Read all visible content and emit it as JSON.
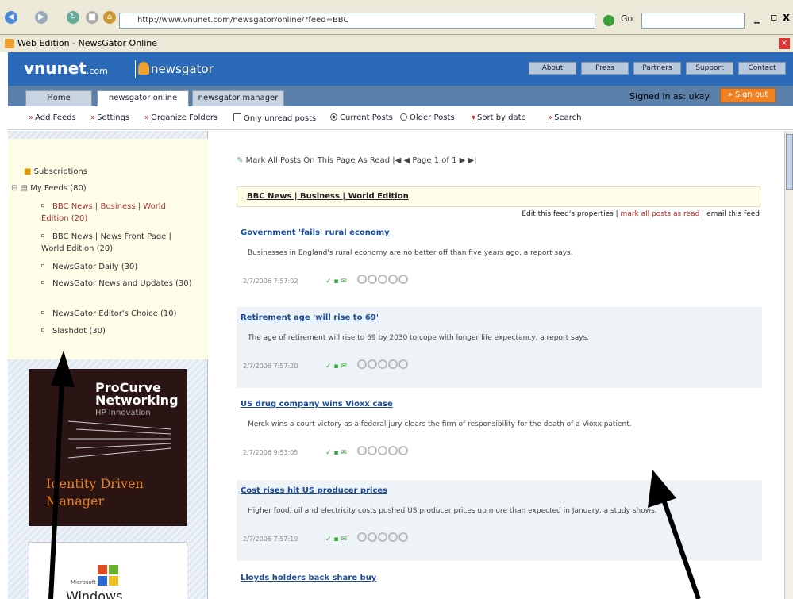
{
  "browser": {
    "url": "http://www.vnunet.com/newsgator/online/?feed=BBC",
    "go_label": "Go",
    "search_value": "",
    "tab_title": "Web Edition - NewsGator Online",
    "minimize": "_",
    "maximize": "B",
    "close": "x"
  },
  "header": {
    "logo": "vnunet",
    "logo_suffix": ".com",
    "logo2": "newsgator",
    "links": [
      "About",
      "Press",
      "Partners",
      "Support",
      "Contact"
    ]
  },
  "nav": {
    "tabs": [
      "Home",
      "newsgator online",
      "newsgator manager"
    ],
    "user": "Signed in as: ukay",
    "signout": "» Sign out"
  },
  "toolbar": {
    "add_feeds": "Add Feeds",
    "settings": "Settings",
    "organize": "Organize Folders",
    "only_unread": "Only unread posts",
    "current_posts": "Current Posts",
    "older_posts": "Older Posts",
    "sort": "Sort by date",
    "search": "Search"
  },
  "sidebar": {
    "root": "My Feeds (80)",
    "root_top": "Subscriptions",
    "feeds": [
      "BBC News | Business | World Edition (20)",
      "BBC News | News Front Page | World Edition (20)",
      "NewsGator Daily (30)",
      "NewsGator News and Updates (30)",
      "NewsGator Editor's Choice (10)",
      "Slashdot (30)"
    ],
    "ad1_title": "ProCurve Networking",
    "ad1_sub": "HP Innovation",
    "ad1_tag": "Identity Driven Manager",
    "ad2_small": "Microsoft",
    "ad2_title": "Windows"
  },
  "main": {
    "pager": "Mark All Posts On This Page As Read   |◀ ◀  Page 1 of 1  ▶ ▶|",
    "crumb": "BBC News | Business | World Edition",
    "actions_prefix": "Edit this feed's properties | ",
    "actions_red": "mark all posts as read",
    "actions_suffix": " | email this feed",
    "articles": [
      {
        "title": "Government 'fails' rural economy",
        "body": "Businesses in England's rural economy are no better off than five years ago, a report says.",
        "meta": "2/7/2006 7:57:02"
      },
      {
        "title": "Retirement age 'will rise to 69'",
        "body": "The age of retirement will rise to 69 by 2030 to cope with longer life expectancy, a report says.",
        "meta": "2/7/2006 7:57:20"
      },
      {
        "title": "US drug company wins Vioxx case",
        "body": "Merck wins a court victory as a federal jury clears the firm of responsibility for the death of a Vioxx patient.",
        "meta": "2/7/2006 9:53:05"
      },
      {
        "title": "Cost rises hit US producer prices",
        "body": "Higher food, oil and electricity costs pushed US producer prices up more than expected in January, a study shows.",
        "meta": "2/7/2006 7:57:19"
      },
      {
        "title": "Lloyds holders back share buy"
      }
    ]
  }
}
